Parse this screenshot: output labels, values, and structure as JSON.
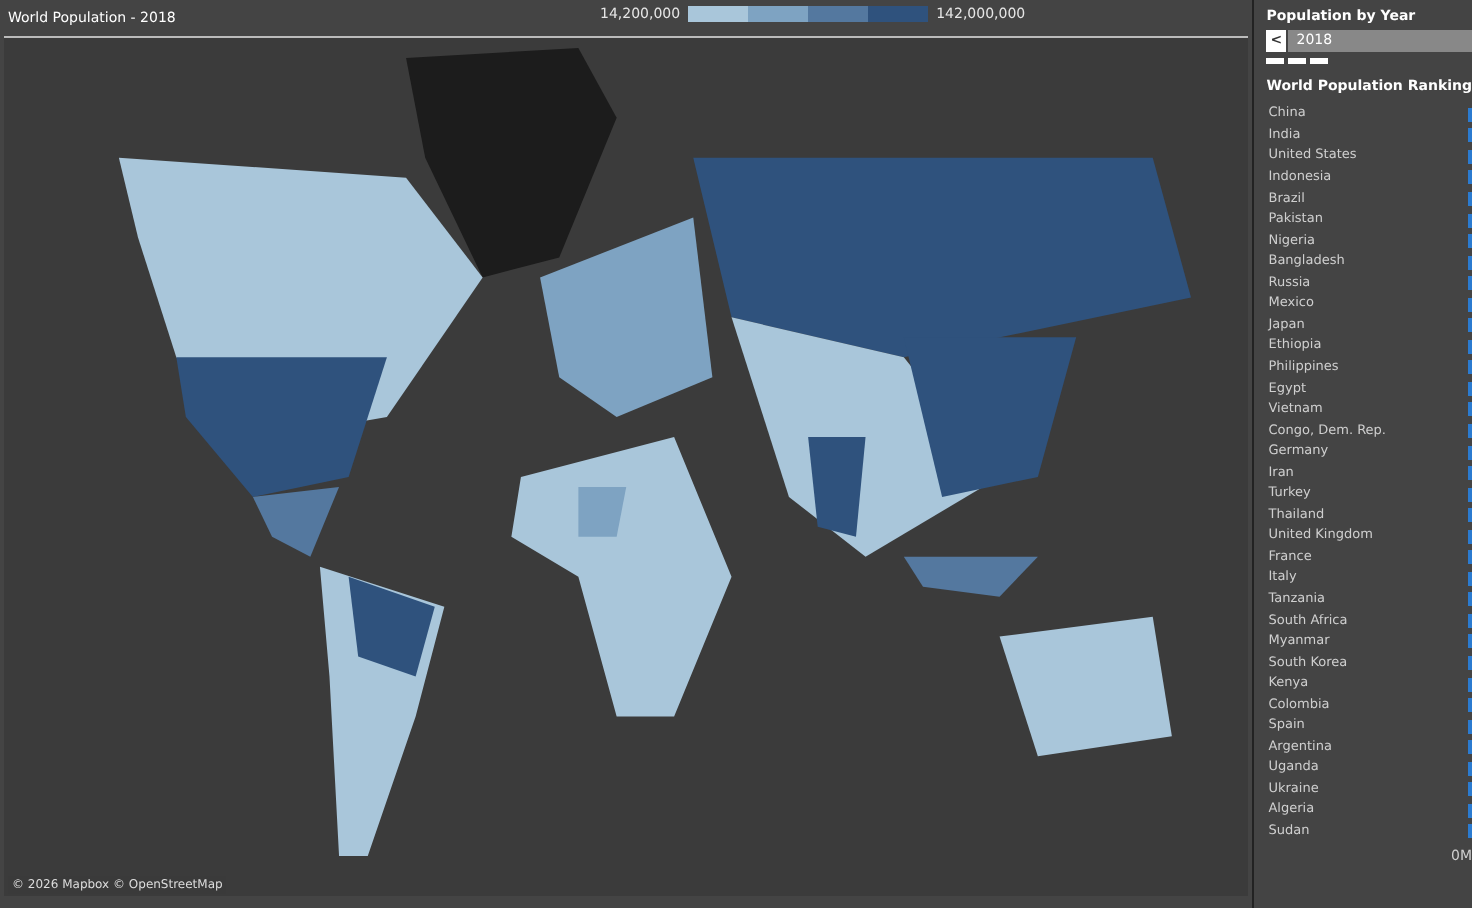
{
  "title": "World Population - 2018",
  "legend": {
    "min": "14,200,000",
    "max": "142,000,000",
    "steps": [
      {
        "color": "#a9c6da"
      },
      {
        "color": "#7ea3c2"
      },
      {
        "color": "#54789f"
      },
      {
        "color": "#2f527d"
      }
    ]
  },
  "map": {
    "attribution": "© 2026 Mapbox © OpenStreetMap"
  },
  "year_filter": {
    "title": "Population by Year",
    "prev": "<",
    "value": "2018"
  },
  "ranking": {
    "title": "World Population Ranking",
    "axis_label": "0M",
    "rows": [
      {
        "country": "China"
      },
      {
        "country": "India"
      },
      {
        "country": "United States"
      },
      {
        "country": "Indonesia"
      },
      {
        "country": "Brazil"
      },
      {
        "country": "Pakistan"
      },
      {
        "country": "Nigeria"
      },
      {
        "country": "Bangladesh"
      },
      {
        "country": "Russia"
      },
      {
        "country": "Mexico"
      },
      {
        "country": "Japan"
      },
      {
        "country": "Ethiopia"
      },
      {
        "country": "Philippines"
      },
      {
        "country": "Egypt"
      },
      {
        "country": "Vietnam"
      },
      {
        "country": "Congo, Dem. Rep."
      },
      {
        "country": "Germany"
      },
      {
        "country": "Iran"
      },
      {
        "country": "Turkey"
      },
      {
        "country": "Thailand"
      },
      {
        "country": "United Kingdom"
      },
      {
        "country": "France"
      },
      {
        "country": "Italy"
      },
      {
        "country": "Tanzania"
      },
      {
        "country": "South Africa"
      },
      {
        "country": "Myanmar"
      },
      {
        "country": "South Korea"
      },
      {
        "country": "Kenya"
      },
      {
        "country": "Colombia"
      },
      {
        "country": "Spain"
      },
      {
        "country": "Argentina"
      },
      {
        "country": "Uganda"
      },
      {
        "country": "Ukraine"
      },
      {
        "country": "Algeria"
      },
      {
        "country": "Sudan"
      }
    ]
  }
}
